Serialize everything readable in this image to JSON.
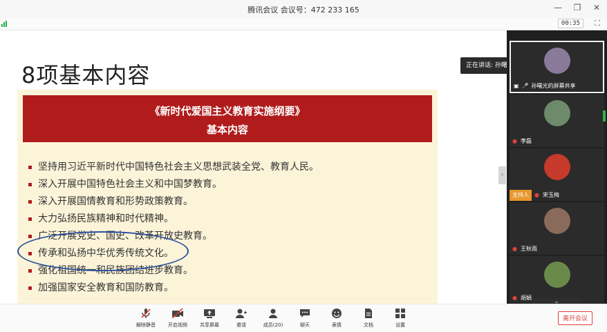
{
  "window": {
    "title": "腾讯会议 会议号：472 233 165",
    "controls": [
      "minimize",
      "maximize",
      "close"
    ]
  },
  "subbar": {
    "timer": "00:35",
    "fullscreen_icon": "fullscreen-icon"
  },
  "slide": {
    "title": "8项基本内容",
    "banner_line1": "《新时代爱国主义教育实施纲要》",
    "banner_line2": "基本内容",
    "items": [
      "坚持用习近平新时代中国特色社会主义思想武装全党、教育人民。",
      "深入开展中国特色社会主义和中国梦教育。",
      "深入开展国情教育和形势政策教育。",
      "大力弘扬民族精神和时代精神。",
      "广泛开展党史、国史、改革开放史教育。",
      "传承和弘扬中华优秀传统文化。",
      "强化祖国统一和民族团结进步教育。",
      "加强国家安全教育和国防教育。"
    ],
    "highlighted_item_index": 5
  },
  "speaking": {
    "label": "正在讲话: 孙曙光"
  },
  "participants": [
    {
      "name": "孙曙光的屏幕共享",
      "active": true
    },
    {
      "name": "李磊",
      "active": false
    },
    {
      "name": "宋玉梅",
      "host_tag": "主持人",
      "active": false
    },
    {
      "name": "王秋雨",
      "active": false
    },
    {
      "name": "胡娟",
      "active": false
    }
  ],
  "toolbar": {
    "unmute": "解除静音",
    "start_video": "开启视频",
    "share_screen": "共享屏幕",
    "invite": "邀请",
    "members": "成员(20)",
    "chat": "聊天",
    "reactions": "表情",
    "docs": "文档",
    "settings": "设置",
    "leave": "离开会议"
  },
  "colors": {
    "banner_red": "#b01c1c",
    "panel_cream": "#fcf4d9",
    "ellipse_blue": "#2b4f9c",
    "host_orange": "#e8962e",
    "leave_red": "#e04040"
  }
}
